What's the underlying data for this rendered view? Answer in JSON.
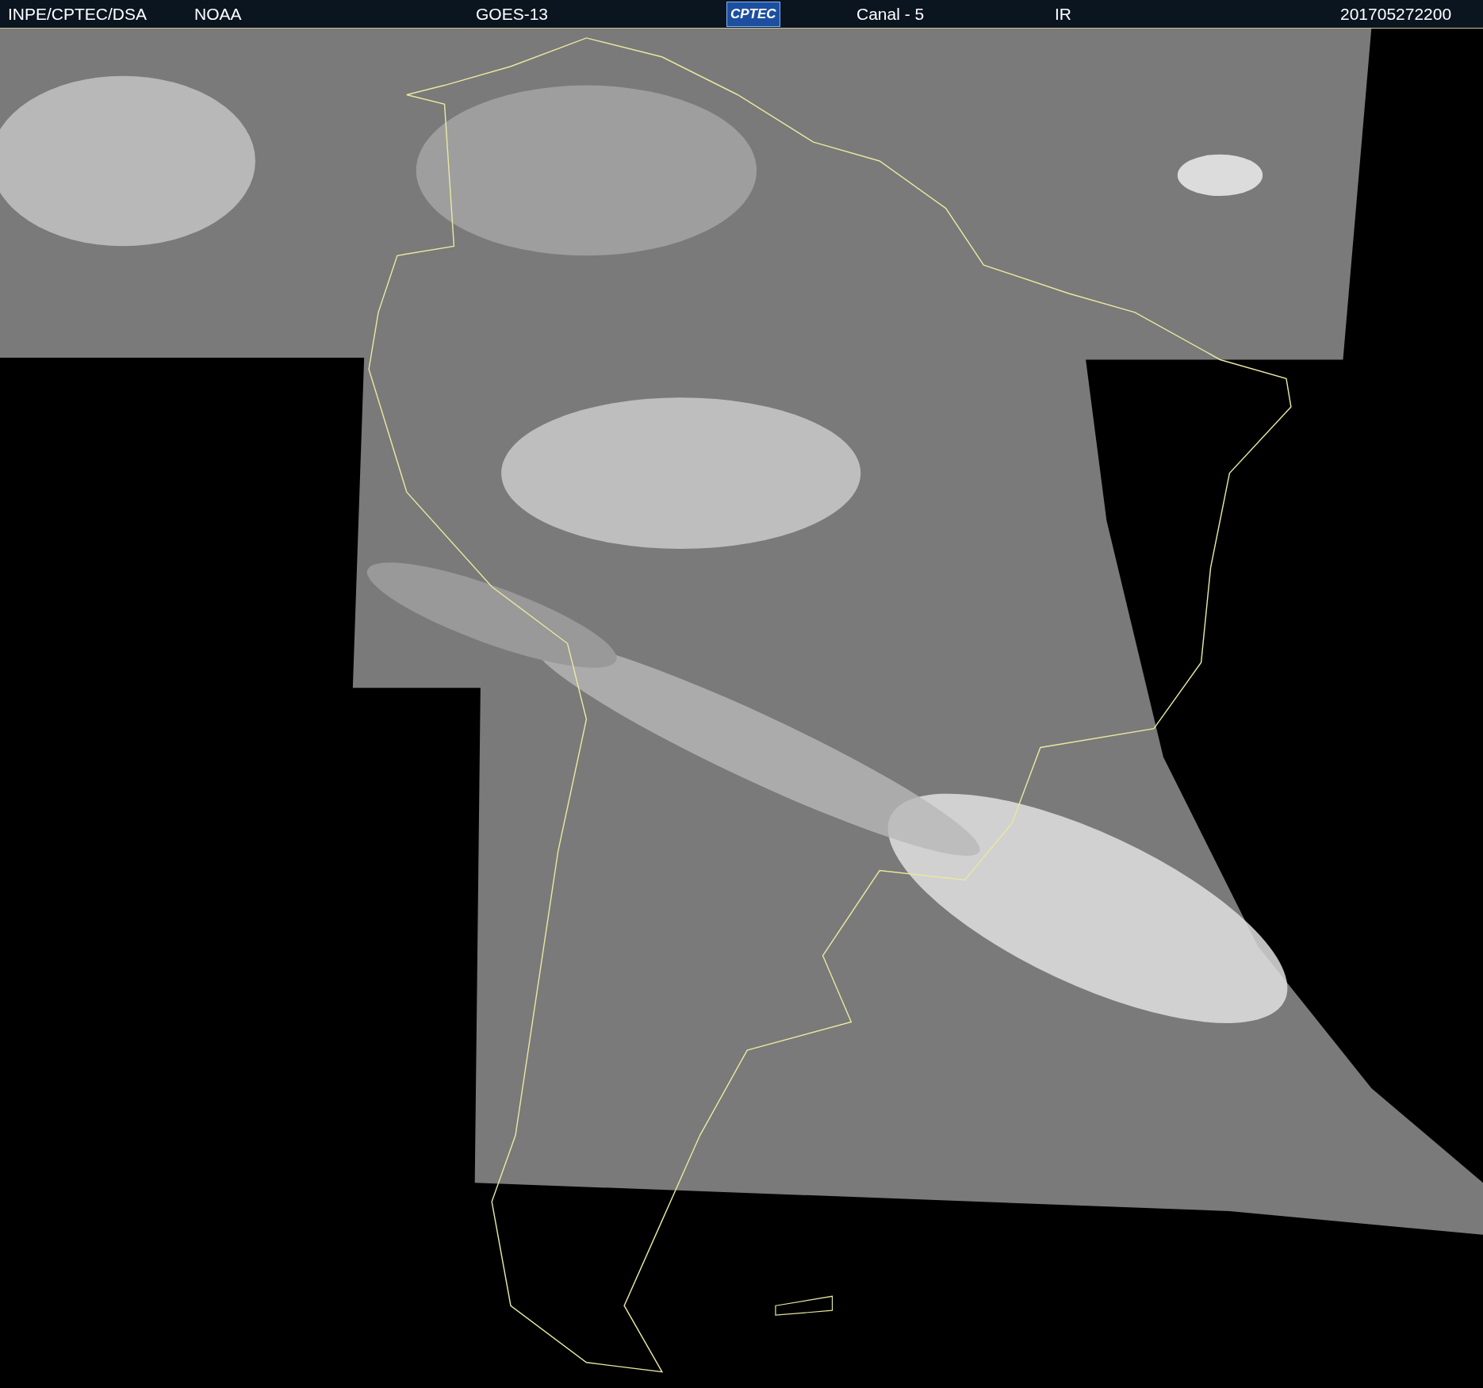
{
  "header": {
    "items": [
      {
        "kind": "text",
        "text": "INPE/CPTEC/DSA"
      },
      {
        "kind": "text",
        "text": "NOAA"
      },
      {
        "kind": "text",
        "text": "GOES-13"
      },
      {
        "kind": "logo",
        "text": "CPTEC"
      },
      {
        "kind": "text",
        "text": "Canal - 5"
      },
      {
        "kind": "text",
        "text": "IR"
      },
      {
        "kind": "text",
        "text": "201705272200"
      }
    ]
  }
}
